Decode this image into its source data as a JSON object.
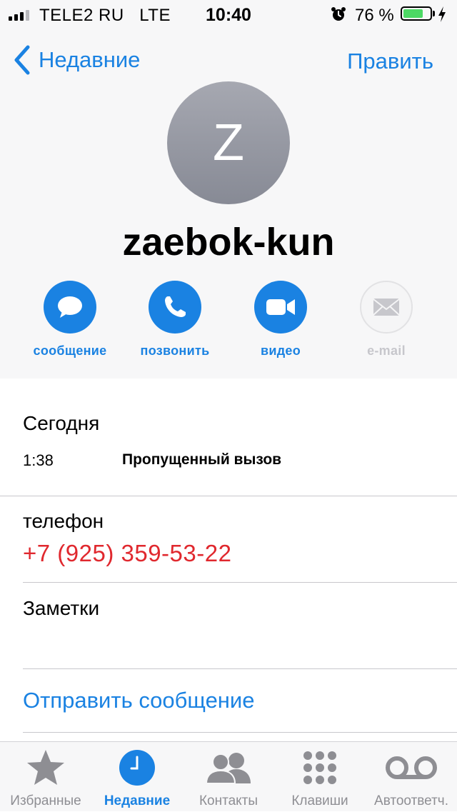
{
  "status_bar": {
    "carrier": "TELE2 RU",
    "network": "LTE",
    "time": "10:40",
    "battery_percent": "76 %",
    "battery_level": 0.76,
    "signal_bars": 3
  },
  "nav": {
    "back_label": "Недавние",
    "edit_label": "Править"
  },
  "contact": {
    "initial": "Z",
    "name": "zaebok-kun"
  },
  "actions": [
    {
      "label": "сообщение",
      "icon": "message-bubble-icon",
      "enabled": true
    },
    {
      "label": "позвонить",
      "icon": "phone-icon",
      "enabled": true
    },
    {
      "label": "видео",
      "icon": "video-camera-icon",
      "enabled": true
    },
    {
      "label": "e-mail",
      "icon": "envelope-icon",
      "enabled": false
    }
  ],
  "recents": {
    "heading": "Сегодня",
    "calls": [
      {
        "time": "1:38",
        "type": "Пропущенный вызов"
      }
    ]
  },
  "phone": {
    "label": "телефон",
    "number": "+7 (925) 359-53-22"
  },
  "notes": {
    "label": "Заметки"
  },
  "send_message_label": "Отправить сообщение",
  "tabs": [
    {
      "label": "Избранные",
      "icon": "star-icon",
      "active": false
    },
    {
      "label": "Недавние",
      "icon": "clock-icon",
      "active": true
    },
    {
      "label": "Контакты",
      "icon": "contacts-icon",
      "active": false
    },
    {
      "label": "Клавиши",
      "icon": "keypad-icon",
      "active": false
    },
    {
      "label": "Автоответч.",
      "icon": "voicemail-icon",
      "active": false
    }
  ],
  "colors": {
    "accent": "#1a82e2",
    "missed_number": "#e0282e",
    "battery": "#4cd964"
  }
}
